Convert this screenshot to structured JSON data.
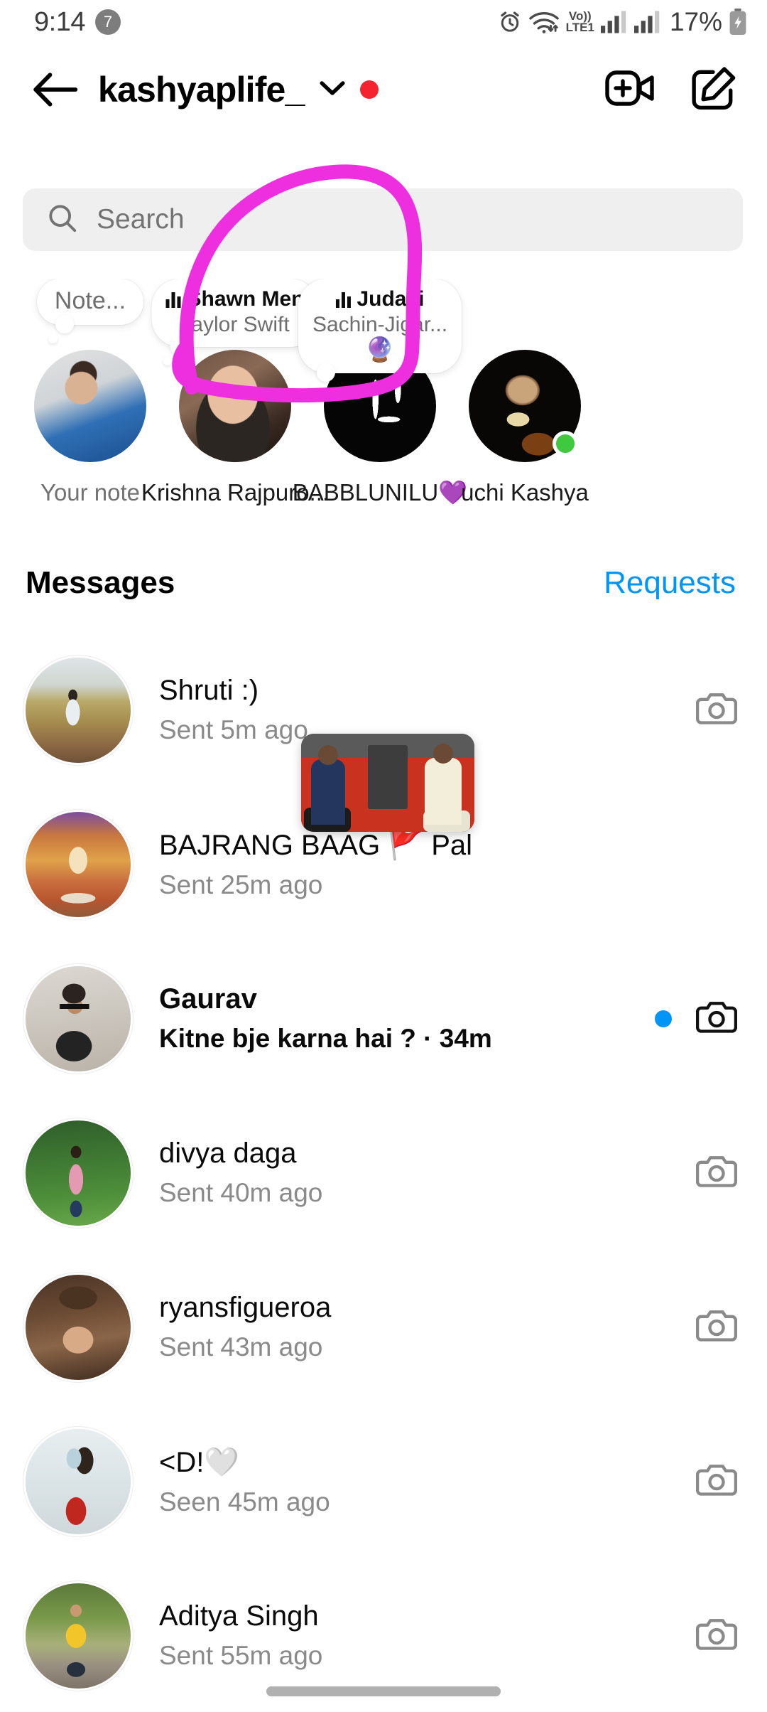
{
  "status_bar": {
    "time": "9:14",
    "notification_count": "7",
    "icons": [
      "alarm-icon",
      "wifi-icon",
      "volte-icon",
      "signal-icon-1",
      "signal-icon-2"
    ],
    "network_label_top": "Vo))",
    "network_label_bottom": "LTE1",
    "battery_percent": "17%"
  },
  "header": {
    "back_label": "back-arrow",
    "account_name": "kashyaplife_",
    "chevron": "chevron-down-icon",
    "status_dot_color": "#f5232f",
    "video_call_label": "video-call-icon",
    "new_message_label": "new-message-icon"
  },
  "search": {
    "placeholder": "Search",
    "icon": "search-icon"
  },
  "stories": [
    {
      "note_type": "text",
      "note_text": "Note...",
      "name": "Your note",
      "name_muted": true,
      "online": false,
      "avatar_style": "selfie-blue"
    },
    {
      "note_type": "music",
      "note_title": "Shawn Men",
      "note_artist": "Taylor Swift",
      "name": "Krishna Rajpuro...",
      "name_muted": false,
      "online": false,
      "avatar_style": "portrait-smile"
    },
    {
      "note_type": "music",
      "note_title": "Judaai",
      "note_artist": "Sachin-Jigar...",
      "note_emoji": "🔮",
      "name": "BABBLUNILU💜",
      "name_muted": false,
      "online": false,
      "avatar_style": "black-logo"
    },
    {
      "note_type": "none",
      "name": "uchi Kashya",
      "name_muted": false,
      "online": true,
      "avatar_style": "dark-lamp"
    }
  ],
  "section": {
    "title": "Messages",
    "action": "Requests",
    "action_color": "#0095f6"
  },
  "messages": [
    {
      "name": "Shruti :)",
      "preview": "Sent 5m ago",
      "unread": false,
      "has_camera": true,
      "avatar_style": "hillside"
    },
    {
      "name": "BAJRANG BAAG 🚩 Pal",
      "preview": "Sent 25m ago",
      "unread": false,
      "has_camera": false,
      "avatar_style": "temple"
    },
    {
      "name": "Gaurav",
      "preview": "Kitne bje karna hai ? · 34m",
      "unread": true,
      "has_camera": true,
      "avatar_style": "sunglasses-guy"
    },
    {
      "name": "divya daga",
      "preview": "Sent 40m ago",
      "unread": false,
      "has_camera": true,
      "avatar_style": "garden-pink"
    },
    {
      "name": "ryansfigueroa",
      "preview": "Sent 43m ago",
      "unread": false,
      "has_camera": true,
      "avatar_style": "brown-portrait"
    },
    {
      "name": "<D!🤍",
      "preview": "Seen 45m ago",
      "unread": false,
      "has_camera": true,
      "avatar_style": "red-skirt"
    },
    {
      "name": "Aditya Singh",
      "preview": "Sent 55m ago",
      "unread": false,
      "has_camera": true,
      "avatar_style": "yellow-shirt"
    }
  ],
  "video_preview": {
    "label": "floating-video-preview"
  },
  "annotation": {
    "color": "#ee2fe0",
    "shape": "hand-drawn-circle"
  }
}
